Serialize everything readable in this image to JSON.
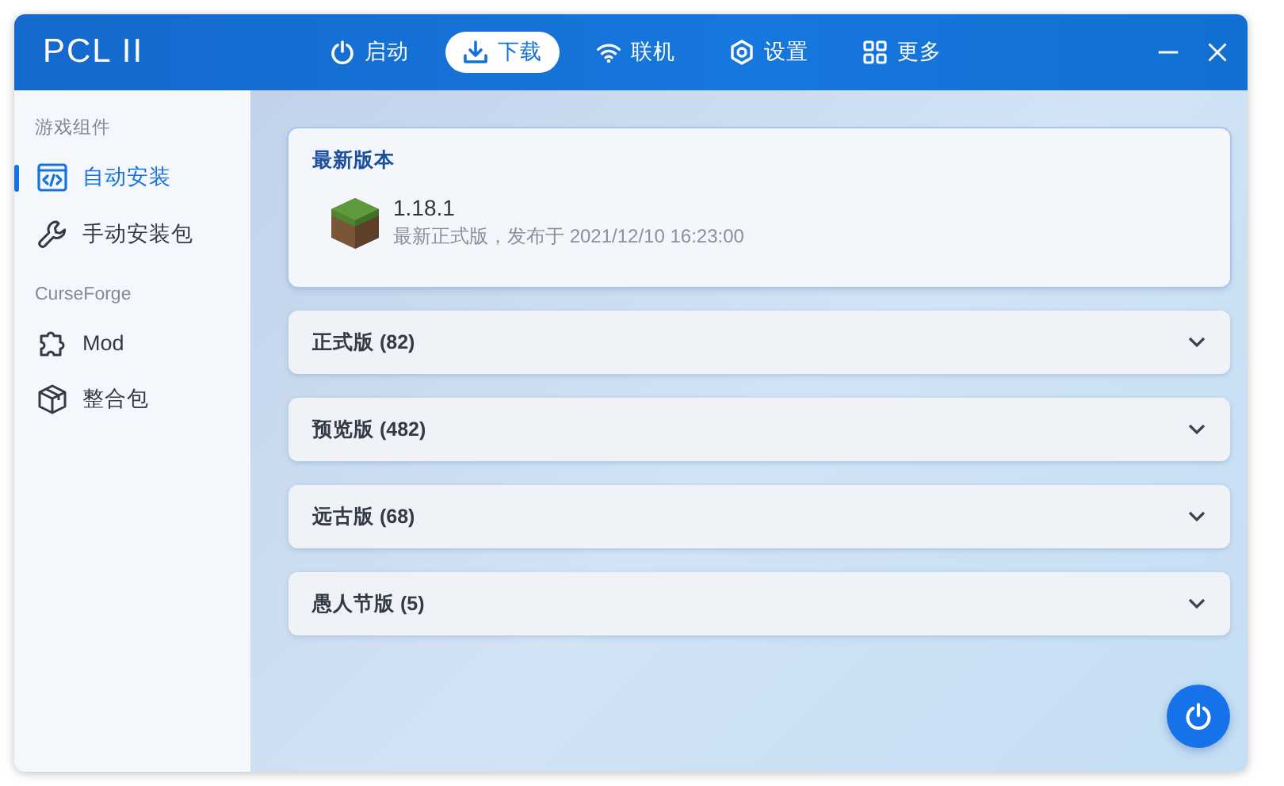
{
  "window": {
    "title": "PCL II"
  },
  "nav": [
    {
      "label": "启动",
      "selected": false
    },
    {
      "label": "下载",
      "selected": true
    },
    {
      "label": "联机",
      "selected": false
    },
    {
      "label": "设置",
      "selected": false
    },
    {
      "label": "更多",
      "selected": false
    }
  ],
  "sidebar": [
    {
      "heading": "游戏组件",
      "items": [
        {
          "label": "自动安装",
          "selected": true
        },
        {
          "label": "手动安装包",
          "selected": false
        }
      ]
    },
    {
      "heading": "CurseForge",
      "items": [
        {
          "label": "Mod",
          "selected": false
        },
        {
          "label": "整合包",
          "selected": false
        }
      ]
    }
  ],
  "latest": {
    "title": "最新版本",
    "version": "1.18.1",
    "description": "最新正式版，发布于 2021/12/10 16:23:00"
  },
  "categories": [
    {
      "label": "正式版 (82)",
      "expanded": false
    },
    {
      "label": "预览版 (482)",
      "expanded": false
    },
    {
      "label": "远古版 (68)",
      "expanded": false
    },
    {
      "label": "愚人节版 (5)",
      "expanded": false
    }
  ]
}
